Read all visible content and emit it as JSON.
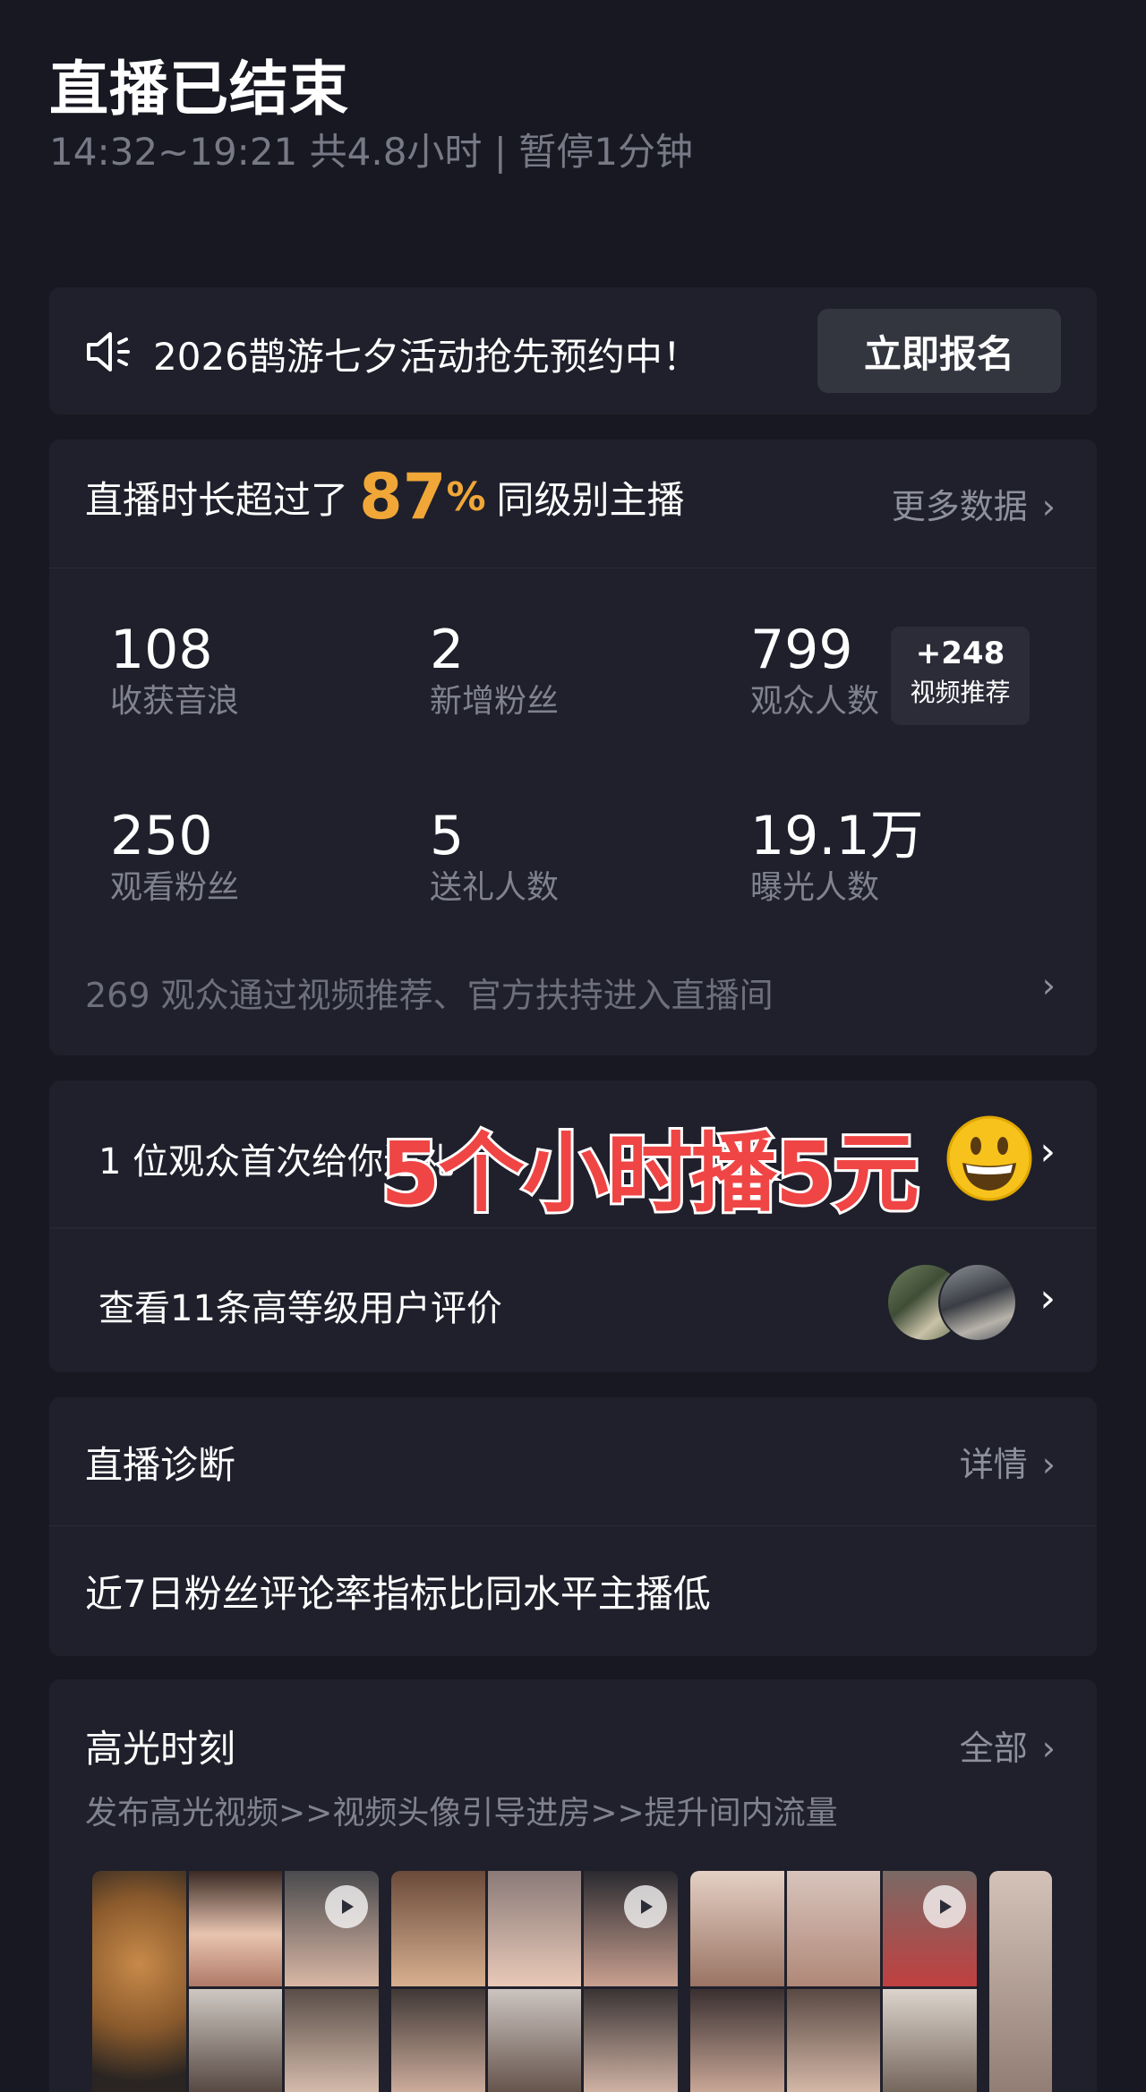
{
  "header": {
    "title": "直播已结束",
    "subtitle": "14:32~19:21 共4.8小时 | 暂停1分钟"
  },
  "banner": {
    "text": "2026鹊游七夕活动抢先预约中！",
    "button_label": "立即报名",
    "icon": "speaker-icon"
  },
  "stats": {
    "head_prefix": "直播时长超过了",
    "percent": "87",
    "percent_sign": "%",
    "head_suffix": "同级别主播",
    "more_label": "更多数据",
    "items": [
      {
        "value": "108",
        "label": "收获音浪"
      },
      {
        "value": "2",
        "label": "新增粉丝"
      },
      {
        "value": "799",
        "label": "观众人数"
      },
      {
        "value": "250",
        "label": "观看粉丝"
      },
      {
        "value": "5",
        "label": "送礼人数"
      },
      {
        "value": "19.1万",
        "label": "曝光人数"
      }
    ],
    "badge_value": "+248",
    "badge_label": "视频推荐",
    "footer": "269 观众通过视频推荐、官方扶持进入直播间"
  },
  "rows": {
    "first_gift": "1 位观众首次给你送礼",
    "reviews": "查看11条高等级用户评价"
  },
  "overlay": {
    "text": "5个小时播5元"
  },
  "diagnosis": {
    "title": "直播诊断",
    "detail_label": "详情",
    "text": "近7日粉丝评论率指标比同水平主播低"
  },
  "highlights": {
    "title": "高光时刻",
    "all_label": "全部",
    "subtitle": "发布高光视频>>视频头像引导进房>>提升间内流量"
  },
  "colors": {
    "background": "#171821",
    "card": "#1f202b",
    "accent": "#f0a737",
    "overlay_red": "#f04545"
  }
}
